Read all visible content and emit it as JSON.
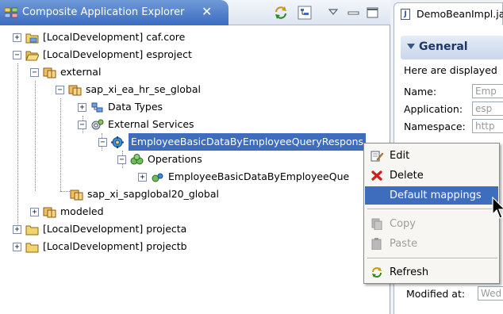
{
  "explorer": {
    "title": "Composite Application Explorer",
    "tree": {
      "caf_core": "[LocalDevelopment] caf.core",
      "esproject": "[LocalDevelopment] esproject",
      "external": "external",
      "sap_global": "sap_xi_ea_hr_se_global",
      "data_types": "Data Types",
      "external_services": "External Services",
      "employee_query": "EmployeeBasicDataByEmployeeQueryRespons",
      "operations": "Operations",
      "employee_query_op": "EmployeeBasicDataByEmployeeQue",
      "sapglobal20": "sap_xi_sapglobal20_global",
      "modeled": "modeled",
      "projecta": "[LocalDevelopment] projecta",
      "projectb": "[LocalDevelopment] projectb"
    }
  },
  "editor": {
    "tab_label": "DemoBeanImpl.ja",
    "section_title": "General",
    "description": "Here are displayed",
    "fields": {
      "name_label": "Name:",
      "name_value": "Emp",
      "application_label": "Application:",
      "application_value": "esp",
      "namespace_label": "Namespace:",
      "namespace_value": "http",
      "modified_label": "Modified at:",
      "modified_value": "Wed"
    }
  },
  "context_menu": {
    "edit": "Edit",
    "delete": "Delete",
    "default_mappings": "Default mappings",
    "copy": "Copy",
    "paste": "Paste",
    "refresh": "Refresh"
  },
  "colors": {
    "selection": "#3e6dbd",
    "tab_blue": "#3b6cc0",
    "folder_yellow": "#f3d36b"
  }
}
